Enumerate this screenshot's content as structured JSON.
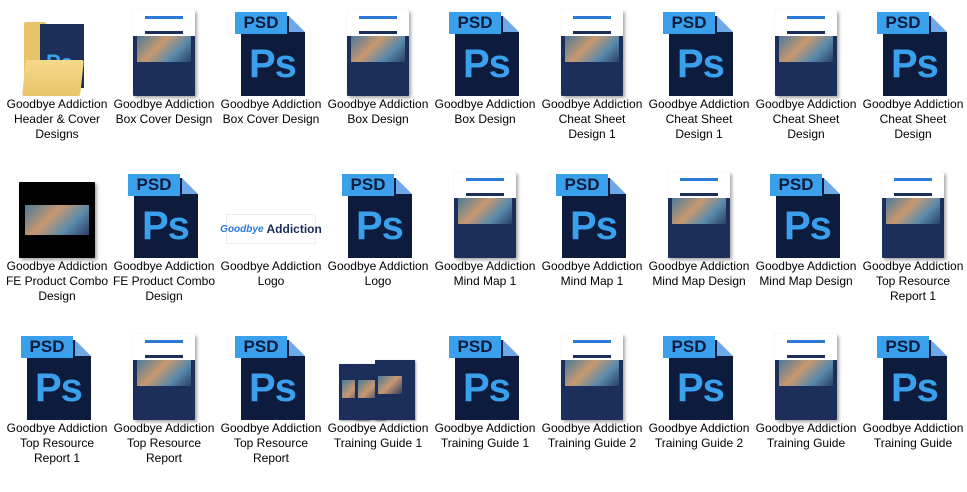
{
  "items": [
    {
      "label": "Goodbye Addiction Header & Cover Designs",
      "kind": "folder"
    },
    {
      "label": "Goodbye Addiction Box Cover Design",
      "kind": "cover"
    },
    {
      "label": "Goodbye Addiction Box Cover Design",
      "kind": "psd"
    },
    {
      "label": "Goodbye Addiction Box Design",
      "kind": "cover"
    },
    {
      "label": "Goodbye Addiction Box Design",
      "kind": "psd"
    },
    {
      "label": "Goodbye Addiction Cheat Sheet Design 1",
      "kind": "cover"
    },
    {
      "label": "Goodbye Addiction Cheat Sheet Design 1",
      "kind": "psd"
    },
    {
      "label": "Goodbye Addiction Cheat Sheet Design",
      "kind": "cover"
    },
    {
      "label": "Goodbye Addiction Cheat Sheet Design",
      "kind": "psd"
    },
    {
      "label": "Goodbye Addiction FE Product Combo Design",
      "kind": "combo"
    },
    {
      "label": "Goodbye Addiction FE Product Combo Design",
      "kind": "psd"
    },
    {
      "label": "Goodbye Addiction Logo",
      "kind": "logo"
    },
    {
      "label": "Goodbye Addiction Logo",
      "kind": "psd"
    },
    {
      "label": "Goodbye Addiction Mind Map 1",
      "kind": "cover"
    },
    {
      "label": "Goodbye Addiction Mind Map 1",
      "kind": "psd"
    },
    {
      "label": "Goodbye Addiction Mind Map Design",
      "kind": "cover"
    },
    {
      "label": "Goodbye Addiction Mind Map Design",
      "kind": "psd"
    },
    {
      "label": "Goodbye Addiction Top Resource Report 1",
      "kind": "cover"
    },
    {
      "label": "Goodbye Addiction Top Resource Report 1",
      "kind": "psd"
    },
    {
      "label": "Goodbye Addiction Top Resource Report",
      "kind": "cover"
    },
    {
      "label": "Goodbye Addiction Top Resource Report",
      "kind": "psd"
    },
    {
      "label": "Goodbye Addiction Training Guide 1",
      "kind": "box3"
    },
    {
      "label": "Goodbye Addiction Training Guide 1",
      "kind": "psd"
    },
    {
      "label": "Goodbye Addiction Training Guide 2",
      "kind": "cover"
    },
    {
      "label": "Goodbye Addiction Training Guide 2",
      "kind": "psd"
    },
    {
      "label": "Goodbye Addiction Training Guide",
      "kind": "cover"
    },
    {
      "label": "Goodbye Addiction Training Guide",
      "kind": "psd"
    }
  ],
  "psd_tag": "PSD",
  "ps_text": "Ps",
  "folder_ps": "Ps",
  "logo_small": "Goodbye",
  "logo_big": "Addiction",
  "colors": {
    "psd_body": "#0d1b3d",
    "psd_accent": "#3aa0ec",
    "cover_navy": "#1b2f5a",
    "folder": "#e8c46a"
  }
}
